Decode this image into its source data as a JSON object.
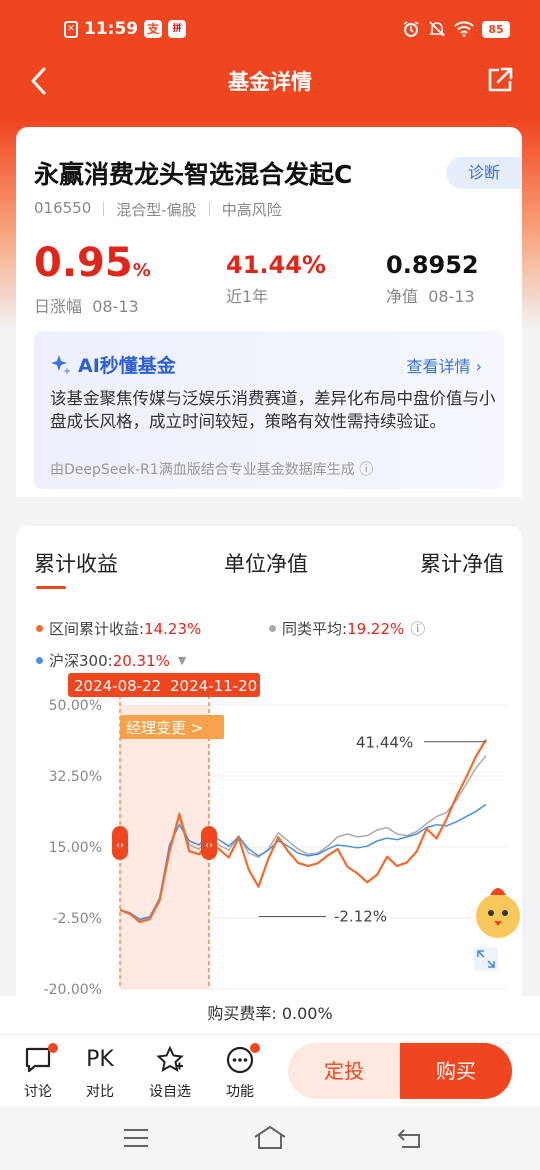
{
  "status_bar": {
    "time": "11:59",
    "battery": "85",
    "app_icon_1": "支",
    "app_icon_2": "拼"
  },
  "navbar": {
    "title": "基金详情"
  },
  "fund": {
    "name": "永赢消费龙头智选混合发起C",
    "diagnose_label": "诊断",
    "code": "016550",
    "type": "混合型-偏股",
    "risk": "中高风险",
    "daily_change": "0.95",
    "daily_change_unit": "%",
    "daily_change_label": "日涨幅",
    "daily_change_date": "08-13",
    "one_year_return": "41.44%",
    "one_year_label": "近1年",
    "nav": "0.8952",
    "nav_label": "净值",
    "nav_date": "08-13"
  },
  "ai_card": {
    "title": "AI秒懂基金",
    "more_label": "查看详情",
    "text": "该基金聚焦传媒与泛娱乐消费赛道，差异化布局中盘价值与小盘成长风格，成立时间较短，策略有效性需持续验证。",
    "source": "由DeepSeek-R1满血版结合专业基金数据库生成"
  },
  "chart_tabs": [
    "累计收益",
    "单位净值",
    "累计净值"
  ],
  "legend": {
    "fund_label": "区间累计收益:",
    "fund_value": "14.23%",
    "peer_label": "同类平均:",
    "peer_value": "19.22%",
    "index_label": "沪深300:",
    "index_value": "20.31%"
  },
  "colors": {
    "brand": "#f0461f",
    "fund_line": "#f26b2c",
    "peer_line": "#aaaaaa",
    "index_line": "#4a90e2",
    "drawdown": "#52c41a"
  },
  "chart_data": {
    "type": "line",
    "y_ticks": [
      "50.00%",
      "32.50%",
      "15.00%",
      "-2.50%",
      "-20.00%"
    ],
    "ylim": [
      -20,
      50
    ],
    "date_range_labels": [
      "2024-08-22",
      "2024-11-20"
    ],
    "event_label": "经理变更",
    "event_arrow": ">",
    "annotations": {
      "max": "41.44%",
      "min": "-2.12%"
    },
    "series": [
      {
        "name": "区间累计收益",
        "values": [
          -0.5,
          -1.5,
          -3.5,
          -2.8,
          1.8,
          13.8,
          23,
          14,
          13.2,
          16.6,
          14.5,
          12.4,
          17.3,
          9.5,
          5.2,
          12.1,
          17.4,
          13.9,
          11.1,
          10.3,
          11,
          12.9,
          14.5,
          10.1,
          8.5,
          6.3,
          8.2,
          12.6,
          10.3,
          11.2,
          13.9,
          19.5,
          17.1,
          21.8,
          27.4,
          32.2,
          37.4,
          41.44
        ]
      },
      {
        "name": "同类平均",
        "values": [
          -0.5,
          -1.3,
          -3,
          -2.5,
          2.5,
          14.2,
          23.5,
          15.5,
          14.5,
          17.5,
          15.5,
          14.2,
          17.8,
          13.5,
          12.5,
          14.5,
          18.5,
          16.5,
          14.5,
          13.2,
          13.5,
          15.2,
          17.5,
          18.2,
          17.5,
          17.8,
          19.2,
          19.8,
          18.2,
          17.8,
          18.8,
          20.8,
          22.5,
          23.5,
          26.5,
          30.5,
          34.5,
          37.5
        ]
      },
      {
        "name": "沪深300",
        "values": [
          -0.5,
          -1.2,
          -2.8,
          -2.2,
          2.2,
          15.5,
          20.5,
          16.5,
          15.5,
          18.5,
          16.8,
          15.2,
          17.5,
          14.5,
          12.8,
          14.2,
          16.5,
          15.2,
          13.5,
          12.8,
          13.2,
          14.5,
          15.5,
          15.2,
          14.8,
          15.2,
          16.5,
          17.2,
          16.8,
          17.5,
          18.2,
          19.8,
          20.5,
          20.2,
          21.2,
          22.5,
          23.8,
          25.5
        ]
      }
    ]
  },
  "fee": {
    "label": "购买费率:",
    "value": "0.00%"
  },
  "bottom_bar": {
    "items": [
      "讨论",
      "对比",
      "设自选",
      "功能"
    ],
    "pk_text": "PK",
    "ding_label": "定投",
    "buy_label": "购买"
  }
}
